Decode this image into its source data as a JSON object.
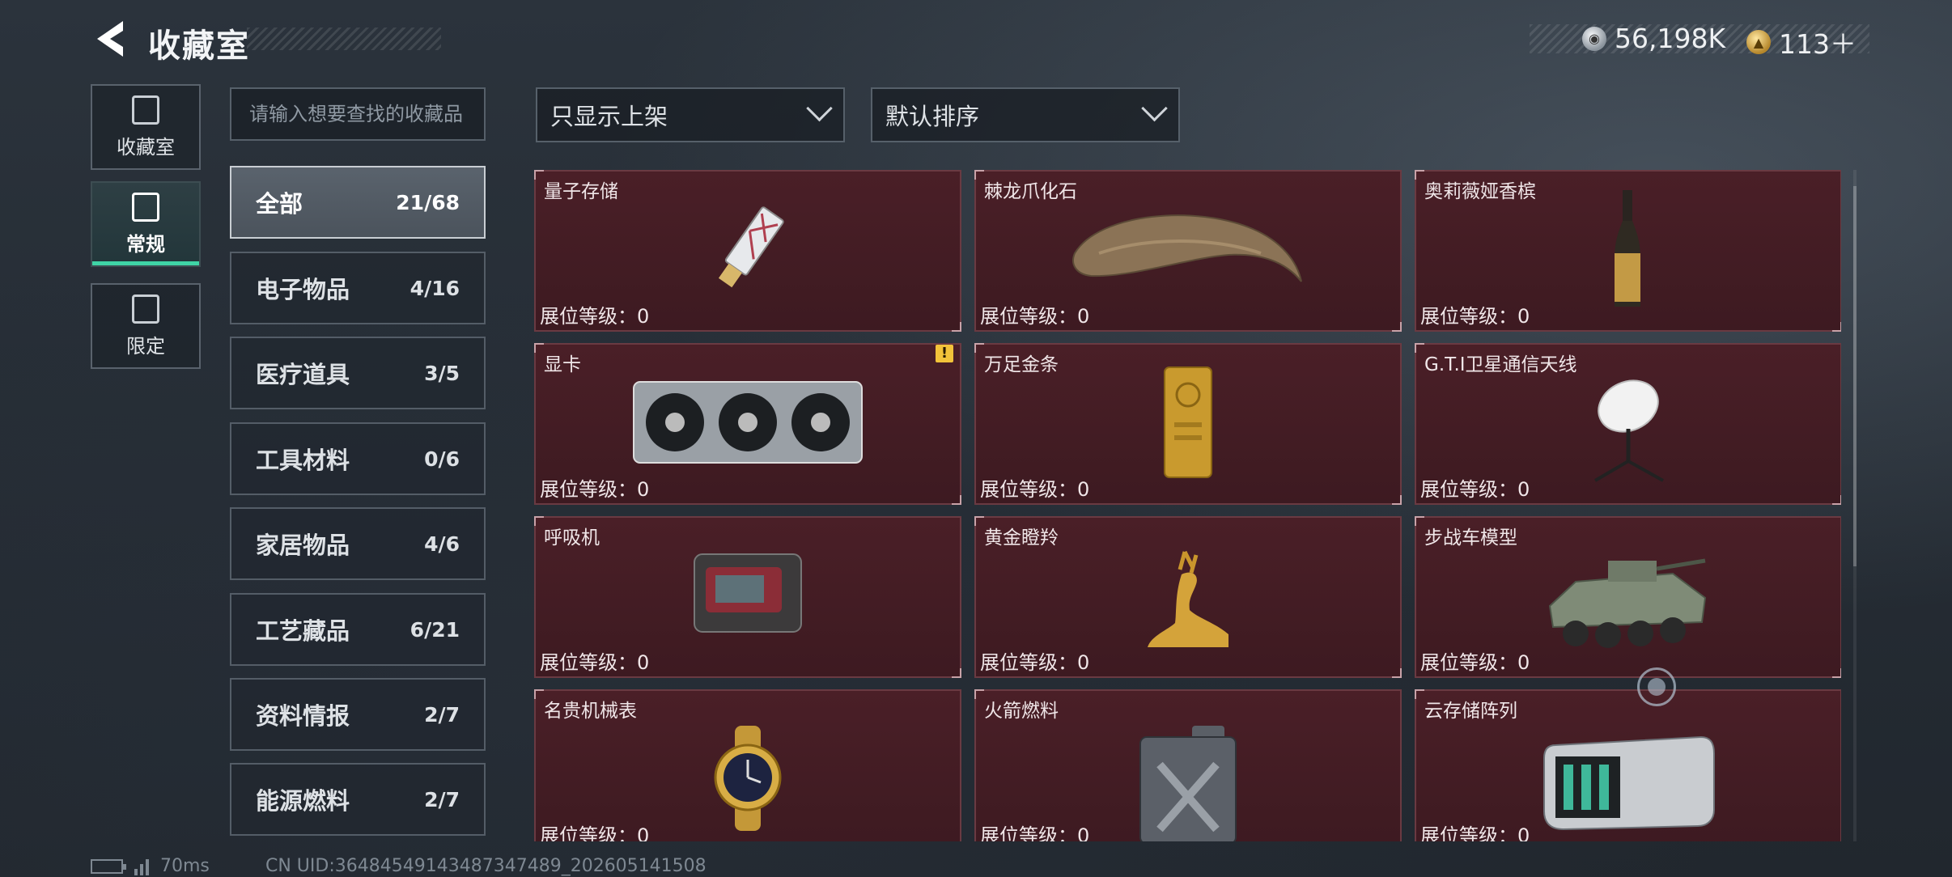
{
  "header": {
    "title": "收藏室",
    "currency": [
      {
        "icon": "silver-coin-icon",
        "value": "56,198K"
      },
      {
        "icon": "gold-coin-icon",
        "value": "113＋"
      }
    ]
  },
  "rail": [
    {
      "label": "收藏室",
      "icon": "collection-icon",
      "active": false
    },
    {
      "label": "常规",
      "icon": "regular-icon",
      "active": true
    },
    {
      "label": "限定",
      "icon": "limited-icon",
      "active": false
    }
  ],
  "search": {
    "placeholder": "请输入想要查找的收藏品"
  },
  "categories": [
    {
      "name": "全部",
      "count": "21/68",
      "active": true
    },
    {
      "name": "电子物品",
      "count": "4/16"
    },
    {
      "name": "医疗道具",
      "count": "3/5"
    },
    {
      "name": "工具材料",
      "count": "0/6"
    },
    {
      "name": "家居物品",
      "count": "4/6"
    },
    {
      "name": "工艺藏品",
      "count": "6/21"
    },
    {
      "name": "资料情报",
      "count": "2/7"
    },
    {
      "name": "能源燃料",
      "count": "2/7"
    }
  ],
  "filters": {
    "shelf_filter": "只显示上架",
    "sort": "默认排序"
  },
  "items": [
    {
      "name": "量子存储",
      "level": "展位等级：0",
      "icon": "quantum-storage-icon"
    },
    {
      "name": "棘龙爪化石",
      "level": "展位等级：0",
      "icon": "claw-fossil-icon"
    },
    {
      "name": "奥莉薇娅香槟",
      "level": "展位等级：0",
      "icon": "champagne-icon"
    },
    {
      "name": "显卡",
      "level": "展位等级：0",
      "icon": "graphics-card-icon",
      "warning": "!"
    },
    {
      "name": "万足金条",
      "level": "展位等级：0",
      "icon": "gold-bar-icon"
    },
    {
      "name": "G.T.I卫星通信天线",
      "level": "展位等级：0",
      "icon": "satellite-dish-icon"
    },
    {
      "name": "呼吸机",
      "level": "展位等级：0",
      "icon": "ventilator-icon"
    },
    {
      "name": "黄金瞪羚",
      "level": "展位等级：0",
      "icon": "golden-gazelle-icon"
    },
    {
      "name": "步战车模型",
      "level": "展位等级：0",
      "icon": "ifv-model-icon"
    },
    {
      "name": "名贵机械表",
      "level": "展位等级：0",
      "icon": "mechanical-watch-icon"
    },
    {
      "name": "火箭燃料",
      "level": "展位等级：0",
      "icon": "fuel-canister-icon"
    },
    {
      "name": "云存储阵列",
      "level": "展位等级：0",
      "icon": "storage-array-icon"
    }
  ],
  "footer": {
    "ping": "70ms",
    "uid": "CN UID:3648454914348734748­9_202605141508"
  }
}
